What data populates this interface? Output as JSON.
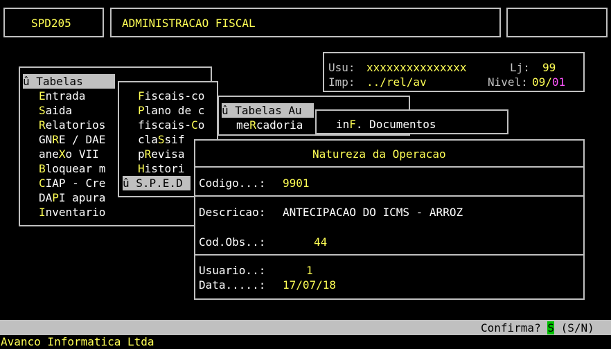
{
  "header": {
    "program_code": "SPD205",
    "module_title": "ADMINISTRACAO FISCAL"
  },
  "user_panel": {
    "user_label": "Usu:",
    "user_value": "xxxxxxxxxxxxxxx",
    "store_label": "Lj:",
    "store_value": "99",
    "printer_label": "Imp:",
    "printer_value": "../rel/av",
    "level_label": "Nivel:",
    "level_value_a": "09/",
    "level_value_b": "01"
  },
  "main_menu": {
    "selected": "û Tabelas",
    "items": [
      {
        "hot": "E",
        "rest": "ntrada"
      },
      {
        "hot": "S",
        "rest": "aida"
      },
      {
        "hot": "R",
        "rest": "elatorios"
      },
      {
        "pre": "GN",
        "hot": "R",
        "rest": "E / DAE"
      },
      {
        "pre": "ane",
        "hot": "X",
        "rest": "o VII"
      },
      {
        "hot": "B",
        "rest": "loquear m"
      },
      {
        "hot": "C",
        "rest": "IAP - Cre"
      },
      {
        "pre": "DA",
        "hot": "P",
        "rest": "I apura"
      },
      {
        "hot": "I",
        "rest": "nventario"
      }
    ]
  },
  "tabelas_menu": {
    "items": [
      {
        "hot": "F",
        "rest": "iscais-co"
      },
      {
        "hot": "P",
        "rest": "lano de c"
      },
      {
        "pre": "fiscais-",
        "hot": "C",
        "rest": "o"
      },
      {
        "pre": "cla",
        "hot": "S",
        "rest": "sif"
      },
      {
        "pre": "p",
        "hot": "R",
        "rest": "evisa"
      },
      {
        "hot": "H",
        "rest": "istori"
      }
    ],
    "selected": "û S.P.E.D"
  },
  "sped_menu": {
    "selected": "û Tabelas Au",
    "item_pre": "me",
    "item_hot": "R",
    "item_rest": "cadoria"
  },
  "tabelas_aux_menu": {
    "item_pre": "in",
    "item_hot": "F",
    "item_rest": ". Documentos"
  },
  "natureza_dialog": {
    "title": "Natureza da Operacao",
    "codigo_label": "Codigo...:",
    "codigo_value": "9901",
    "descricao_label": "Descricao:",
    "descricao_value": "ANTECIPACAO DO ICMS - ARROZ",
    "codobs_label": "Cod.Obs..:",
    "codobs_value": "44",
    "usuario_label": "Usuario..:",
    "usuario_value": "1",
    "data_label": "Data.....:",
    "data_value": "17/07/18"
  },
  "status_bar": {
    "prompt": "Confirma?",
    "answer": "S",
    "options": "(S/N)"
  },
  "footer": {
    "company": "Avanco Informatica Ltda"
  },
  "colors": {
    "background": "#000000",
    "text": "#c0c0c0",
    "highlight": "#ffff55",
    "accent": "#ff55ff",
    "confirm_answer_bg": "#00c000"
  }
}
